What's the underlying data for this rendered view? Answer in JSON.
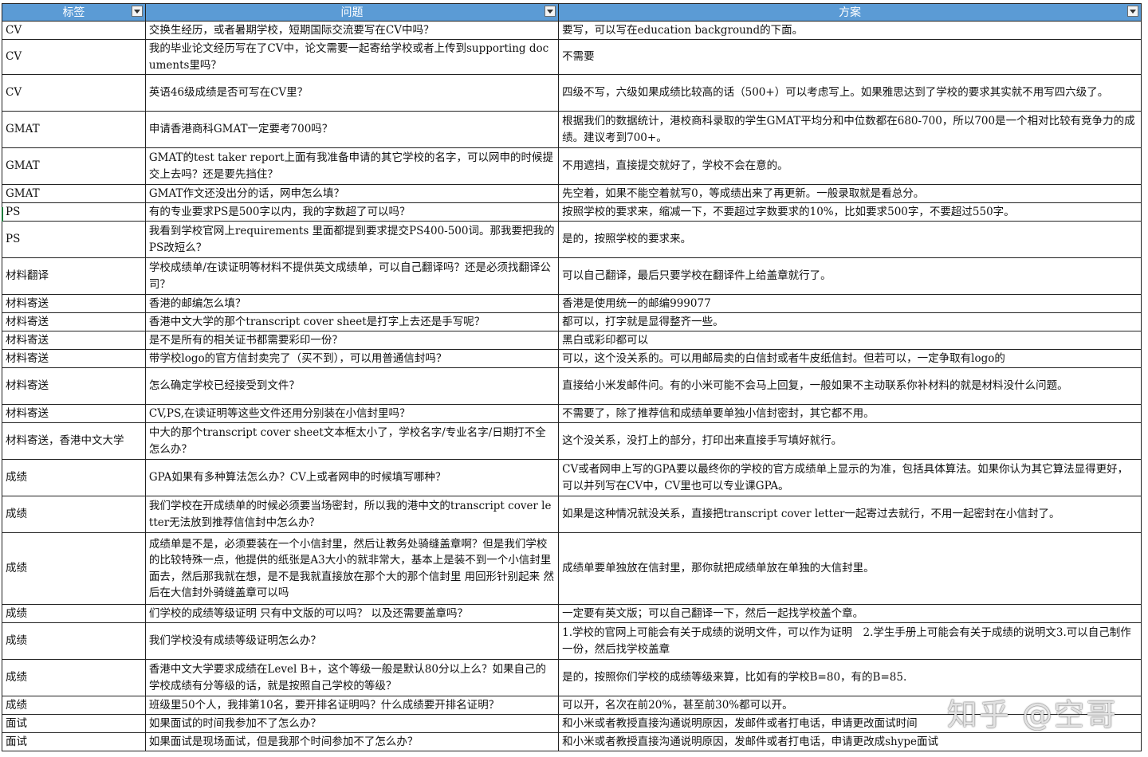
{
  "headers": {
    "tag": "标签",
    "question": "问题",
    "answer": "方案"
  },
  "rows": [
    {
      "tag": "CV",
      "q": "交换生经历，或者暑期学校，短期国际交流要写在CV中吗？",
      "a": "要写，可以写在education background的下面。",
      "h": 23
    },
    {
      "tag": "CV",
      "q": "我的毕业论文经历写在了CV中，论文需要一起寄给学校或者上传到supporting documents里吗？",
      "a": "不需要",
      "h": 44
    },
    {
      "tag": "CV",
      "q": "英语46级成绩是否可写在CV里？",
      "a": "四级不写，六级如果成绩比较高的话（500+）可以考虑写上。如果雅思达到了学校的要求其实就不用写四六级了。",
      "h": 46
    },
    {
      "tag": "GMAT",
      "q": "申请香港商科GMAT一定要考700吗？",
      "a": "根据我们的数据统计，港校商科录取的学生GMAT平均分和中位数都在680-700，所以700是一个相对比较有竞争力的成绩。建议考到700+。",
      "h": 46
    },
    {
      "tag": "GMAT",
      "q": "GMAT的test taker report上面有我准备申请的其它学校的名字，可以网申的时候提交上去吗？还是要先挡住？",
      "a": "不用遮挡，直接提交就好了，学校不会在意的。",
      "h": 46
    },
    {
      "tag": "GMAT",
      "q": "GMAT作文还没出分的话，网申怎么填？",
      "a": "先空着，如果不能空着就写0，等成绩出来了再更新。一般录取就是看总分。",
      "h": 23
    },
    {
      "tag": "PS",
      "q": "有的专业要求PS是500字以内，我的字数超了可以吗？",
      "a": "按照学校的要求来，缩减一下，不要超过字数要求的10%，比如要求500字，不要超过550字。",
      "h": 23
    },
    {
      "tag": "PS",
      "q": "我看到学校官网上requirements 里面都提到要求提交PS400-500词。那我要把我的PS改短么？",
      "a": "是的，按照学校的要求来。",
      "h": 46
    },
    {
      "tag": "材料翻译",
      "q": "学校成绩单/在读证明等材料不提供英文成绩单，可以自己翻译吗？还是必须找翻译公司？",
      "a": "可以自己翻译，最后只要学校在翻译件上给盖章就行了。",
      "h": 46
    },
    {
      "tag": "材料寄送",
      "q": "香港的邮编怎么填？",
      "a": "香港是使用统一的邮编999077",
      "h": 23
    },
    {
      "tag": "材料寄送",
      "q": "香港中文大学的那个transcript cover sheet是打字上去还是手写呢？",
      "a": "都可以，打字就是显得整齐一些。",
      "h": 23
    },
    {
      "tag": "材料寄送",
      "q": "是不是所有的相关证书都需要彩印一份？",
      "a": "黑白或彩印都可以",
      "h": 23
    },
    {
      "tag": "材料寄送",
      "q": "带学校logo的官方信封卖完了（买不到），可以用普通信封吗？",
      "a": "可以，这个没关系的。可以用邮局卖的白信封或者牛皮纸信封。但若可以，一定争取有logo的",
      "h": 23
    },
    {
      "tag": "材料寄送",
      "q": "怎么确定学校已经接受到文件？",
      "a": "直接给小米发邮件问。有的小米可能不会马上回复，一般如果不主动联系你补材料的就是材料没什么问题。",
      "h": 46
    },
    {
      "tag": "材料寄送",
      "q": "CV,PS,在读证明等这些文件还用分别装在小信封里吗？",
      "a": "不需要了，除了推荐信和成绩单要单独小信封密封，其它都不用。",
      "h": 23
    },
    {
      "tag": "材料寄送，香港中文大学",
      "q": "中大的那个transcript cover sheet文本框太小了，学校名字/专业名字/日期打不全怎么办？",
      "a": "这个没关系，没打上的部分，打印出来直接手写填好就行。",
      "h": 46
    },
    {
      "tag": "成绩",
      "q": "GPA如果有多种算法怎么办？CV上或者网申的时候填写哪种？",
      "a": "CV或者网申上写的GPA要以最终你的学校的官方成绩单上显示的为准，包括具体算法。如果你认为其它算法显得更好，可以并列写在CV中，CV里也可以专业课GPA。",
      "h": 46
    },
    {
      "tag": "成绩",
      "q": "我们学校在开成绩单的时候必须要当场密封，所以我的港中文的transcript cover letter无法放到推荐信信封中怎么办？",
      "a": "如果是这种情况就没关系，直接把transcript cover letter一起寄过去就行，不用一起密封在小信封了。",
      "h": 46
    },
    {
      "tag": "成绩",
      "q": "成绩单是不是，必须要装在一个小信封里，然后让教务处骑缝盖章啊？但是我们学校的比较特殊一点，他提供的纸张是A3大小的就非常大，基本上是装不到一个小信封里面去，然后那我就在想，是不是我就直接放在那个大的那个信封里 用回形针别起来 然后在大信封外骑缝盖章可以吗",
      "a": "成绩单要单独放在信封里，那你就把成绩单放在单独的大信封里。",
      "h": 90
    },
    {
      "tag": "成绩",
      "q": "们学校的成绩等级证明 只有中文版的可以吗？ 以及还需要盖章吗？",
      "a": "一定要有英文版；可以自己翻译一下，然后一起找学校盖个章。",
      "h": 23
    },
    {
      "tag": "成绩",
      "q": "我们学校没有成绩等级证明怎么办？",
      "a": "1.学校的官网上可能会有关于成绩的说明文件，可以作为证明　2.学生手册上可能会有关于成绩的说明文3.可以自己制作一份，然后找学校盖章",
      "h": 46
    },
    {
      "tag": "成绩",
      "q": "香港中文大学要求成绩在Level B+，这个等级一般是默认80分以上么？如果自己的学校成绩有分等级的话，就是按照自己学校的等级？",
      "a": "是的，按照你们学校的成绩等级来算，比如有的学校B=80，有的B=85.",
      "h": 46
    },
    {
      "tag": "成绩",
      "q": "班级里50个人，我排第10名，要开排名证明吗？什么成绩要开排名证明？",
      "a": "可以开，名次在前20%，甚至前30%都可以开。",
      "h": 23
    },
    {
      "tag": "面试",
      "q": "如果面试的时间我参加不了怎么办？",
      "a": "和小米或者教授直接沟通说明原因，发邮件或者打电话，申请更改面试时间",
      "h": 23
    },
    {
      "tag": "面试",
      "q": "如果面试是现场面试，但是我那个时间参加不了怎么办？",
      "a": "和小米或者教授直接沟通说明原因，发邮件或者打电话，申请更改成shype面试",
      "h": 23
    }
  ],
  "watermark": "知乎 @空哥"
}
